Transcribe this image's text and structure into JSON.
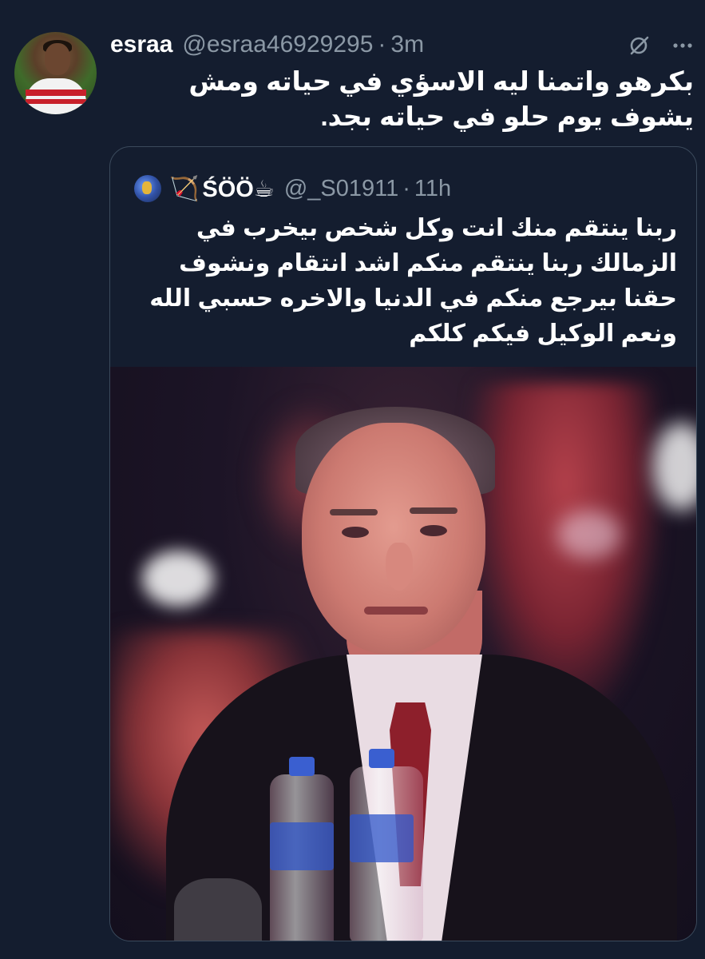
{
  "tweet": {
    "author_name": "esraa",
    "author_handle": "@esraa46929295",
    "separator": "·",
    "time": "3m",
    "text": "بكرهو واتمنا ليه الاسؤي في حياته ومش يشوف يوم حلو في حياته بجد."
  },
  "icons": {
    "grok": "grok-icon",
    "more": "more-icon"
  },
  "quoted": {
    "emoji_prefix": "🏹",
    "author_name": "ŚÖÖ☕",
    "author_handle": "@_S01911",
    "separator": "·",
    "time": "11h",
    "text": "ربنا ينتقم منك انت وكل شخص بيخرب في الزمالك ربنا ينتقم منكم اشد انتقام ونشوف حقنا بيرجع منكم في الدنيا والاخره حسبي الله ونعم الوكيل فيكم كلكم"
  },
  "colors": {
    "background": "#141d2f",
    "secondary_text": "#8b98a5",
    "border": "#3b4a5c"
  }
}
